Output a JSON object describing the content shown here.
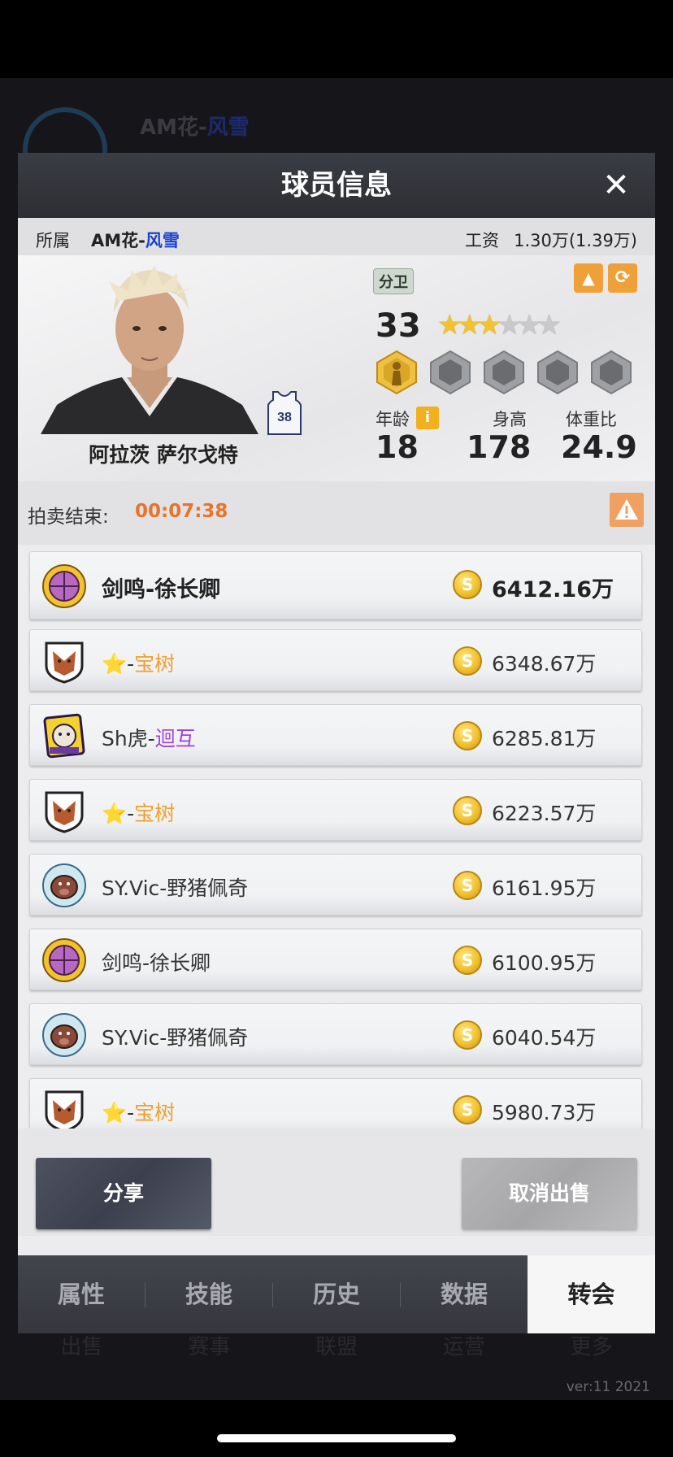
{
  "background": {
    "team_label": "AM花-",
    "team_label_blue": "风雪",
    "nav": [
      "出售",
      "赛事",
      "联盟",
      "运营",
      "更多"
    ],
    "version": "ver:11  2021"
  },
  "modal": {
    "title": "球员信息",
    "close": "✕"
  },
  "info_bar": {
    "affiliation_label": "所属",
    "affiliation_team_prefix": "AM花-",
    "affiliation_team_suffix": "风雪",
    "salary_label": "工资",
    "salary_value": "1.30万(1.39万)"
  },
  "player": {
    "name": "阿拉茨 萨尔戈特",
    "jersey_number": "38",
    "position": "分卫",
    "overall": "33",
    "stars_filled": 3,
    "stars_total": 6,
    "age_label": "年龄",
    "age": "18",
    "height_label": "身高",
    "height": "178",
    "weight_ratio_label": "体重比",
    "weight_ratio": "24.9"
  },
  "auction": {
    "label": "拍卖结束:",
    "time": "00:07:38"
  },
  "bids": [
    {
      "prefix": "剑鸣-徐长卿",
      "highlight": "",
      "highlight_color": "",
      "amount": "6412.16万",
      "logo": "basketball-badge-icon"
    },
    {
      "prefix": "⭐-",
      "highlight": "宝树",
      "highlight_color": "orange",
      "amount": "6348.67万",
      "logo": "boar-shield-icon"
    },
    {
      "prefix": "Sh虎-",
      "highlight": "迴互",
      "highlight_color": "purple",
      "amount": "6285.81万",
      "logo": "tiger-emblem-icon"
    },
    {
      "prefix": "⭐-",
      "highlight": "宝树",
      "highlight_color": "orange",
      "amount": "6223.57万",
      "logo": "boar-shield-icon"
    },
    {
      "prefix": "SY.Vic-野猪佩奇",
      "highlight": "",
      "highlight_color": "",
      "amount": "6161.95万",
      "logo": "boar-round-icon"
    },
    {
      "prefix": "剑鸣-徐长卿",
      "highlight": "",
      "highlight_color": "",
      "amount": "6100.95万",
      "logo": "basketball-badge-icon"
    },
    {
      "prefix": "SY.Vic-野猪佩奇",
      "highlight": "",
      "highlight_color": "",
      "amount": "6040.54万",
      "logo": "boar-round-icon"
    },
    {
      "prefix": "⭐-",
      "highlight": "宝树",
      "highlight_color": "orange",
      "amount": "5980.73万",
      "logo": "boar-shield-icon"
    }
  ],
  "buttons": {
    "share": "分享",
    "cancel_sale": "取消出售"
  },
  "tabs": [
    "属性",
    "技能",
    "历史",
    "数据",
    "转会"
  ],
  "active_tab": "转会",
  "coin_symbol": "S"
}
